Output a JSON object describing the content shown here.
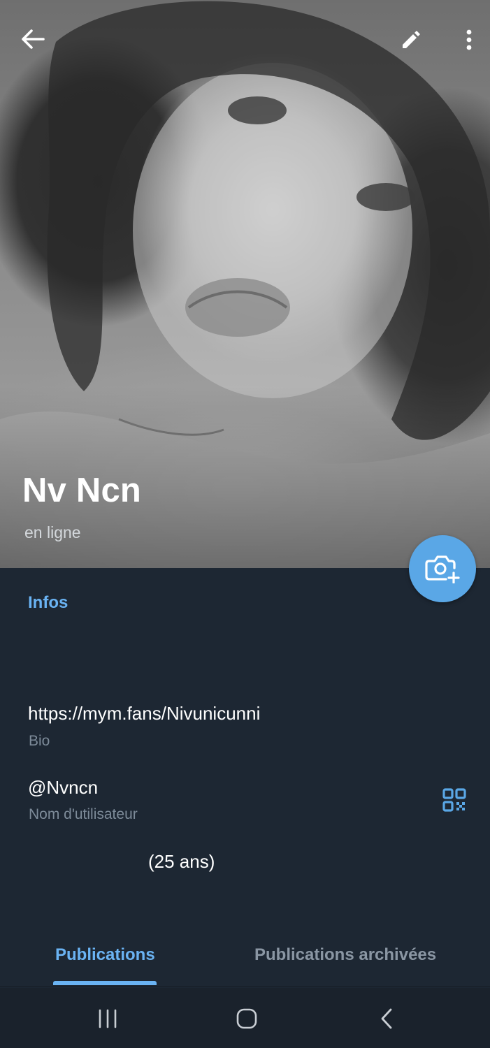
{
  "profile": {
    "name": "Nv Ncn",
    "status": "en ligne"
  },
  "toolbar": {
    "back_icon": "arrow-left-icon",
    "edit_icon": "pencil-icon",
    "more_icon": "more-vertical-icon"
  },
  "fab": {
    "icon": "camera-add-icon",
    "color": "#5aa7e6"
  },
  "info": {
    "section_title": "Infos",
    "bio": {
      "value": "https://mym.fans/Nivunicunni",
      "caption": "Bio"
    },
    "username": {
      "value": "@Nvncn",
      "caption": "Nom d'utilisateur",
      "icon": "qr-code-icon"
    },
    "age": "(25 ans)"
  },
  "tabs": [
    {
      "label": "Publications",
      "active": true
    },
    {
      "label": "Publications archivées",
      "active": false
    }
  ],
  "navbar": {
    "recent_icon": "recent-apps-icon",
    "home_icon": "home-icon",
    "back_icon": "nav-back-icon"
  },
  "colors": {
    "accent": "#6ab3f3",
    "background": "#1d2733",
    "caption": "#7d8b99"
  }
}
